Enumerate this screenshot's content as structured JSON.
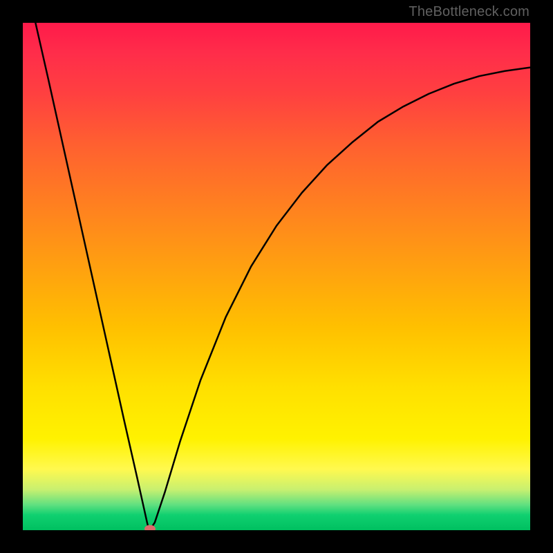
{
  "watermark": "TheBottleneck.com",
  "chart_data": {
    "type": "line",
    "title": "",
    "xlabel": "",
    "ylabel": "",
    "xlim": [
      0,
      1
    ],
    "ylim": [
      0,
      1
    ],
    "series": [
      {
        "name": "curve",
        "x": [
          0.025,
          0.05,
          0.1,
          0.15,
          0.2,
          0.225,
          0.245,
          0.248,
          0.252,
          0.26,
          0.28,
          0.31,
          0.35,
          0.4,
          0.45,
          0.5,
          0.55,
          0.6,
          0.65,
          0.7,
          0.75,
          0.8,
          0.85,
          0.9,
          0.95,
          1.0
        ],
        "y": [
          1.0,
          0.89,
          0.665,
          0.44,
          0.215,
          0.105,
          0.015,
          0.003,
          0.003,
          0.015,
          0.075,
          0.175,
          0.295,
          0.42,
          0.52,
          0.6,
          0.665,
          0.72,
          0.765,
          0.805,
          0.835,
          0.86,
          0.88,
          0.895,
          0.905,
          0.912
        ]
      }
    ],
    "marker": {
      "x": 0.25,
      "y": 0.003
    },
    "background_gradient": {
      "top": "#ff1a4a",
      "bottom": "#00c060"
    }
  }
}
